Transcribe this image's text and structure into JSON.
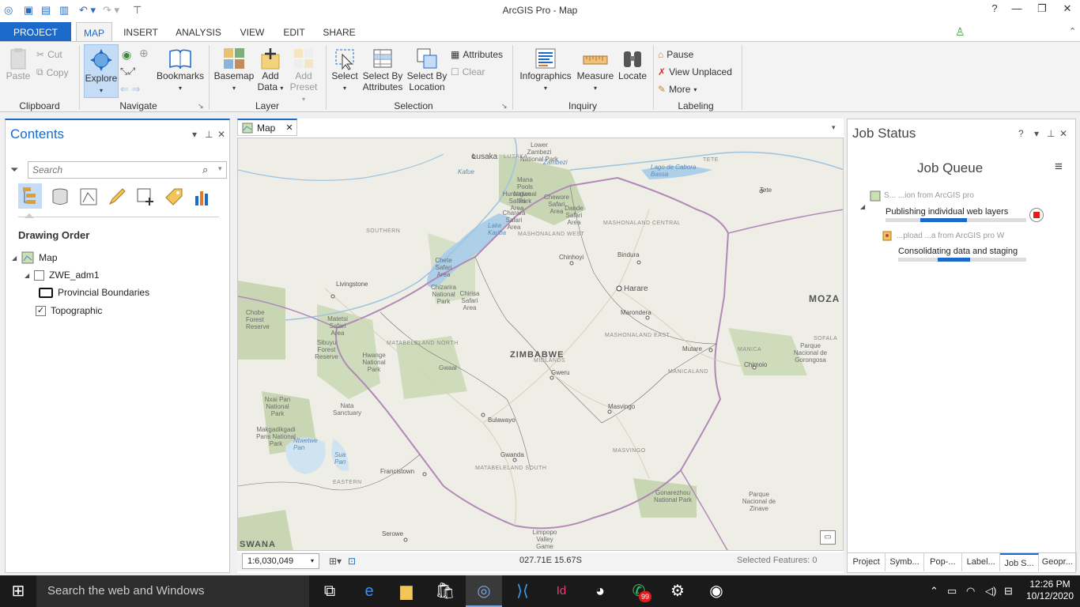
{
  "window": {
    "title": "ArcGIS Pro - Map",
    "help": "?",
    "minimize": "—",
    "restore": "❐",
    "close": "✕"
  },
  "tabs": [
    "PROJECT",
    "MAP",
    "INSERT",
    "ANALYSIS",
    "VIEW",
    "EDIT",
    "SHARE"
  ],
  "ribbon": {
    "clipboard": {
      "paste": "Paste",
      "cut": "Cut",
      "copy": "Copy",
      "label": "Clipboard"
    },
    "navigate": {
      "explore": "Explore",
      "bookmarks": "Bookmarks",
      "label": "Navigate"
    },
    "layer": {
      "basemap": "Basemap",
      "add_data": "Add",
      "add_data2": "Data",
      "add_preset": "Add",
      "add_preset2": "Preset",
      "label": "Layer"
    },
    "selection": {
      "select": "Select",
      "select_by_attr1": "Select By",
      "select_by_attr2": "Attributes",
      "select_by_loc1": "Select By",
      "select_by_loc2": "Location",
      "attributes": "Attributes",
      "clear": "Clear",
      "label": "Selection"
    },
    "inquiry": {
      "infographics": "Infographics",
      "measure": "Measure",
      "locate": "Locate",
      "label": "Inquiry"
    },
    "labeling": {
      "pause": "Pause",
      "view_unplaced": "View Unplaced",
      "more": "More",
      "label": "Labeling"
    }
  },
  "contents": {
    "title": "Contents",
    "search_placeholder": "Search",
    "drawing_order": "Drawing Order",
    "tree": {
      "map": "Map",
      "layer1": "ZWE_adm1",
      "legend1": "Provincial Boundaries",
      "layer2": "Topographic",
      "layer2_checked": "✓"
    }
  },
  "map": {
    "tab_label": "Map",
    "scale": "1:6,030,049",
    "coordinates": "027.71E 15.67S",
    "selected_features": "Selected Features: 0",
    "labels": {
      "zimbabwe": "ZIMBABWE",
      "moza": "MOZA",
      "swana": "SWANA",
      "lusaka": "Lusaka",
      "livingstone": "Livingstone",
      "harare": "Harare",
      "bulawayo": "Bulawayo",
      "gweru": "Gweru",
      "masvingo": "Masvingo",
      "mutare": "Mutare",
      "chinhoyi": "Chinhoyi",
      "bindura": "Bindura",
      "marondera": "Marondera",
      "kwekwe": "Gwanda",
      "francistown": "Francistown",
      "serowe": "Serowe",
      "chimoio": "Chimoio",
      "tete": "Tete",
      "tete_region": "TETE",
      "southern": "SOUTHERN",
      "eastern": "EASTERN",
      "mashonaland_west": "MASHONALAND WEST",
      "mashonaland_central": "MASHONALAND CENTRAL",
      "mashonaland_east": "MASHONALAND EAST",
      "matabeleland_north": "MATABELELAND NORTH",
      "matabeleland_south": "MATABELELAND SOUTH",
      "midlands": "MIDLANDS",
      "masvingo_region": "MASVINGO",
      "manicaland": "MANICALAND",
      "manica": "MANICA",
      "sofala": "SOFALA",
      "lake_kariba": "Lake Kariba",
      "lago_cabora": "Lago de Cabora Bassa",
      "lower_zambezi": "Lower Zambezi National Park",
      "hwange": "Hwange National Park",
      "chobe": "Chobe Forest Reserve",
      "gonarezhou": "Gonarezhou National Park",
      "parque_gorongosa": "Parque Nacional de Gorongosa",
      "parque_zinave": "Parque Nacional de Zinave",
      "matetsi": "Matetsi Safari Area",
      "chizarira": "Chizarira National Park",
      "chirisa": "Chirisa Safari Area",
      "nxai_pan": "Nxai Pan National Park",
      "makgadikgadi": "Makgadikgadi Pans National Park",
      "nata": "Nata Sanctuary",
      "sua_pan": "Sua Pan",
      "ntwetwe": "Ntwetwe Pan",
      "chewore": "Chewore Safari Area",
      "dande": "Dande Safari Area",
      "charara": "Charara Safari Area",
      "chete": "Chete Safari Area",
      "sijarira": "Sibuyu Forest Reserve",
      "mana_pools": "Mana Pools National Park",
      "hurungwe": "Hurungwe Safari Area",
      "gwaai": "Gwaai",
      "limpopo": "Limpopo Valley Game Reserve",
      "zambezi": "Zambezi",
      "kafue": "Kafue",
      "lusaka_region": "LUSAKA"
    }
  },
  "job_status": {
    "title": "Job Status",
    "queue_title": "Job Queue",
    "job1_name": "S... ...ion from ArcGIS pro",
    "job1_step": "Publishing individual web layers",
    "job1_progress": 0.33,
    "job2_name": "...pload ...a from ArcGIS pro W",
    "job2_step": "Consolidating data and staging",
    "job2_progress": 0.25,
    "bottom_tabs": [
      "Project",
      "Symb...",
      "Pop-...",
      "Label...",
      "Job S...",
      "Geopr..."
    ]
  },
  "taskbar": {
    "search": "Search the web and Windows",
    "time": "12:26 PM",
    "date": "10/12/2020",
    "whatsapp_badge": "99"
  },
  "colors": {
    "accent": "#1b6ac9",
    "stop": "#e21b1b",
    "park_green": "#c9d6b4",
    "water": "#aecfe8"
  }
}
